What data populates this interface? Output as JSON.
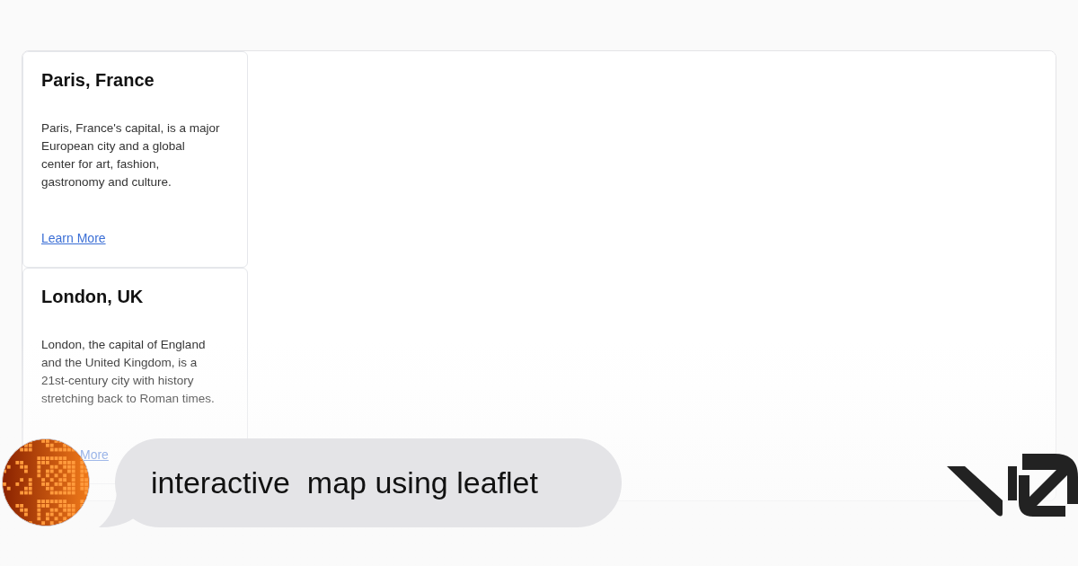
{
  "cards": [
    {
      "title": "Paris, France",
      "description": "Paris, France's capital, is a major European city and a global center for art, fashion, gastronomy and culture.",
      "link": {
        "text": "Learn More"
      }
    },
    {
      "title": "London, UK",
      "description": "London, the capital of England and the United Kingdom, is a 21st-century city with history stretching back to Roman times.",
      "link": {
        "text": "More",
        "partly_covered": true
      }
    }
  ],
  "prompt": {
    "text": "interactive  map using leaflet"
  }
}
